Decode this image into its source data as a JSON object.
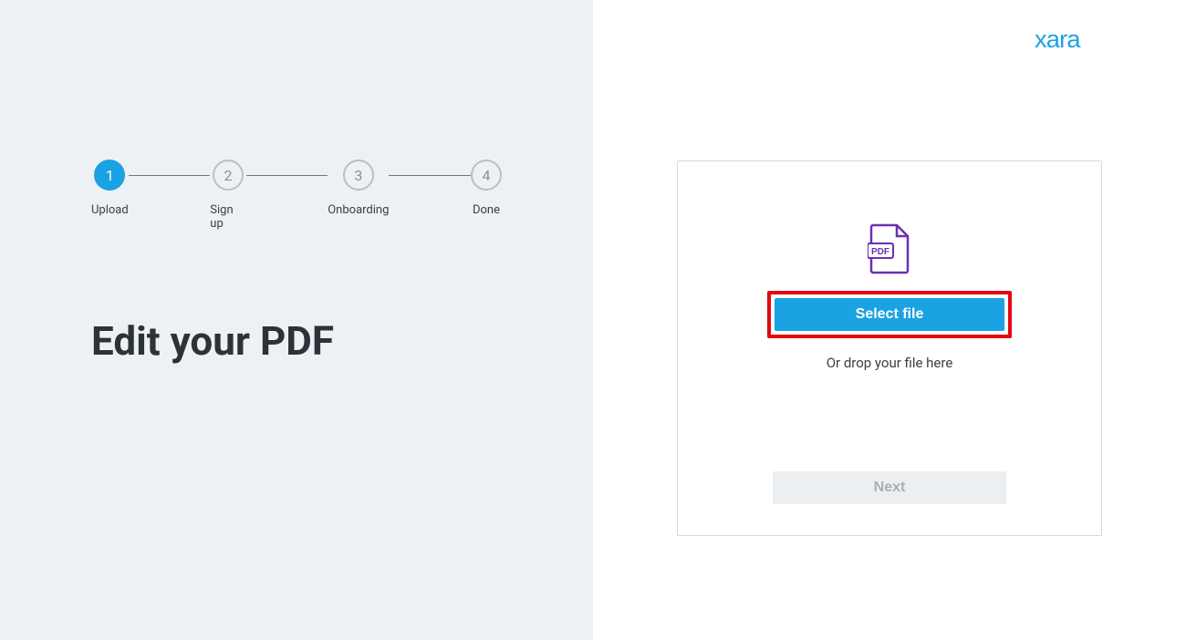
{
  "logo": "xara",
  "steps": [
    {
      "num": "1",
      "label": "Upload",
      "active": true
    },
    {
      "num": "2",
      "label": "Sign up",
      "active": false
    },
    {
      "num": "3",
      "label": "Onboarding",
      "active": false
    },
    {
      "num": "4",
      "label": "Done",
      "active": false
    }
  ],
  "heading": "Edit your PDF",
  "pdf_icon_label": "PDF",
  "select_file_label": "Select file",
  "drop_text": "Or drop your file here",
  "next_label": "Next"
}
